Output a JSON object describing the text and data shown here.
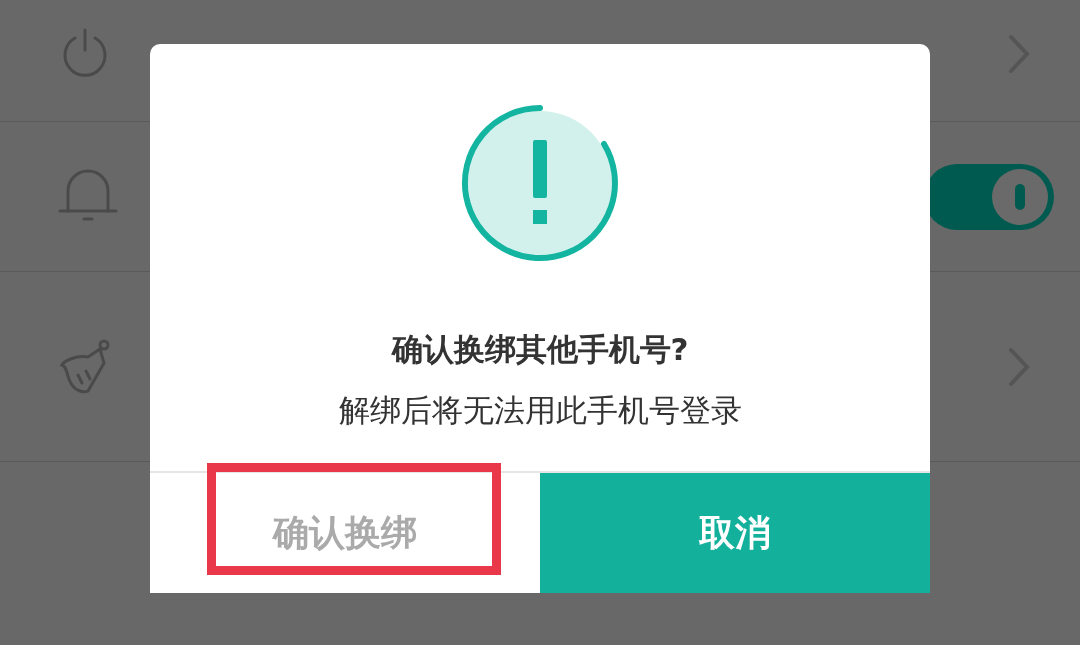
{
  "settings": [
    {
      "kind": "link"
    },
    {
      "kind": "toggle",
      "on": true
    },
    {
      "kind": "link"
    }
  ],
  "dialog": {
    "title": "确认换绑其他手机号?",
    "message": "解绑后将无法用此手机号登录",
    "buttons": [
      {
        "label": "确认换绑",
        "kind": "secondary",
        "highlighted": true
      },
      {
        "label": "取消",
        "kind": "primary",
        "highlighted": false
      }
    ]
  }
}
